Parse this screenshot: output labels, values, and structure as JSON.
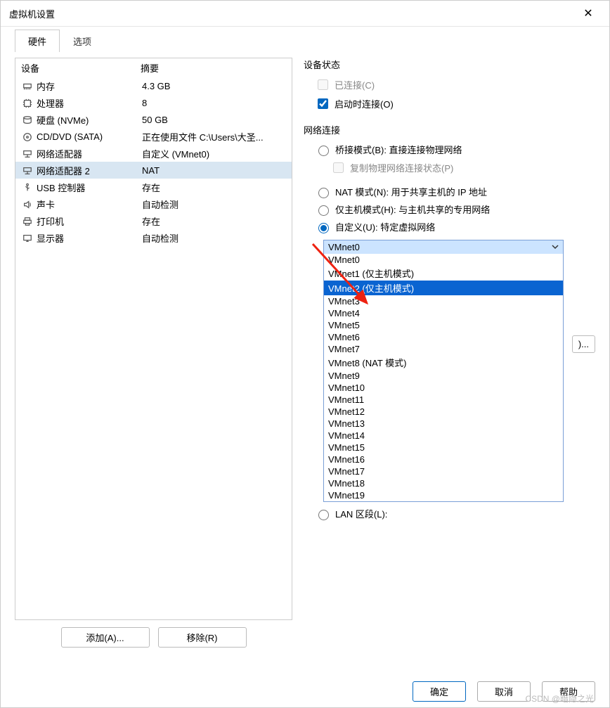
{
  "window": {
    "title": "虚拟机设置",
    "close": "✕"
  },
  "tabs": {
    "hardware": "硬件",
    "options": "选项"
  },
  "devheader": {
    "col1": "设备",
    "col2": "摘要"
  },
  "devices": [
    {
      "icon": "memory",
      "name": "内存",
      "summary": "4.3 GB"
    },
    {
      "icon": "cpu",
      "name": "处理器",
      "summary": "8"
    },
    {
      "icon": "disk",
      "name": "硬盘 (NVMe)",
      "summary": "50 GB"
    },
    {
      "icon": "cd",
      "name": "CD/DVD (SATA)",
      "summary": "正在使用文件 C:\\Users\\大圣..."
    },
    {
      "icon": "net",
      "name": "网络适配器",
      "summary": "自定义 (VMnet0)"
    },
    {
      "icon": "net",
      "name": "网络适配器 2",
      "summary": "NAT"
    },
    {
      "icon": "usb",
      "name": "USB 控制器",
      "summary": "存在"
    },
    {
      "icon": "sound",
      "name": "声卡",
      "summary": "自动检测"
    },
    {
      "icon": "printer",
      "name": "打印机",
      "summary": "存在"
    },
    {
      "icon": "display",
      "name": "显示器",
      "summary": "自动检测"
    }
  ],
  "leftbtns": {
    "add": "添加(A)...",
    "remove": "移除(R)"
  },
  "status": {
    "title": "设备状态",
    "connected": "已连接(C)",
    "poweron": "启动时连接(O)"
  },
  "net": {
    "title": "网络连接",
    "bridged": "桥接模式(B): 直接连接物理网络",
    "replicate": "复制物理网络连接状态(P)",
    "nat": "NAT 模式(N): 用于共享主机的 IP 地址",
    "host": "仅主机模式(H): 与主机共享的专用网络",
    "custom": "自定义(U): 特定虚拟网络",
    "lan": "LAN 区段(L):"
  },
  "dropdown": {
    "selected": "VMnet0",
    "items": [
      "VMnet0",
      "VMnet1 (仅主机模式)",
      "VMnet2 (仅主机模式)",
      "VMnet3",
      "VMnet4",
      "VMnet5",
      "VMnet6",
      "VMnet7",
      "VMnet8 (NAT 模式)",
      "VMnet9",
      "VMnet10",
      "VMnet11",
      "VMnet12",
      "VMnet13",
      "VMnet14",
      "VMnet15",
      "VMnet16",
      "VMnet17",
      "VMnet18",
      "VMnet19"
    ]
  },
  "advanced": ")...",
  "footer": {
    "ok": "确定",
    "cancel": "取消",
    "help": "帮助"
  },
  "watermark": "CSDN @暗隐之光"
}
